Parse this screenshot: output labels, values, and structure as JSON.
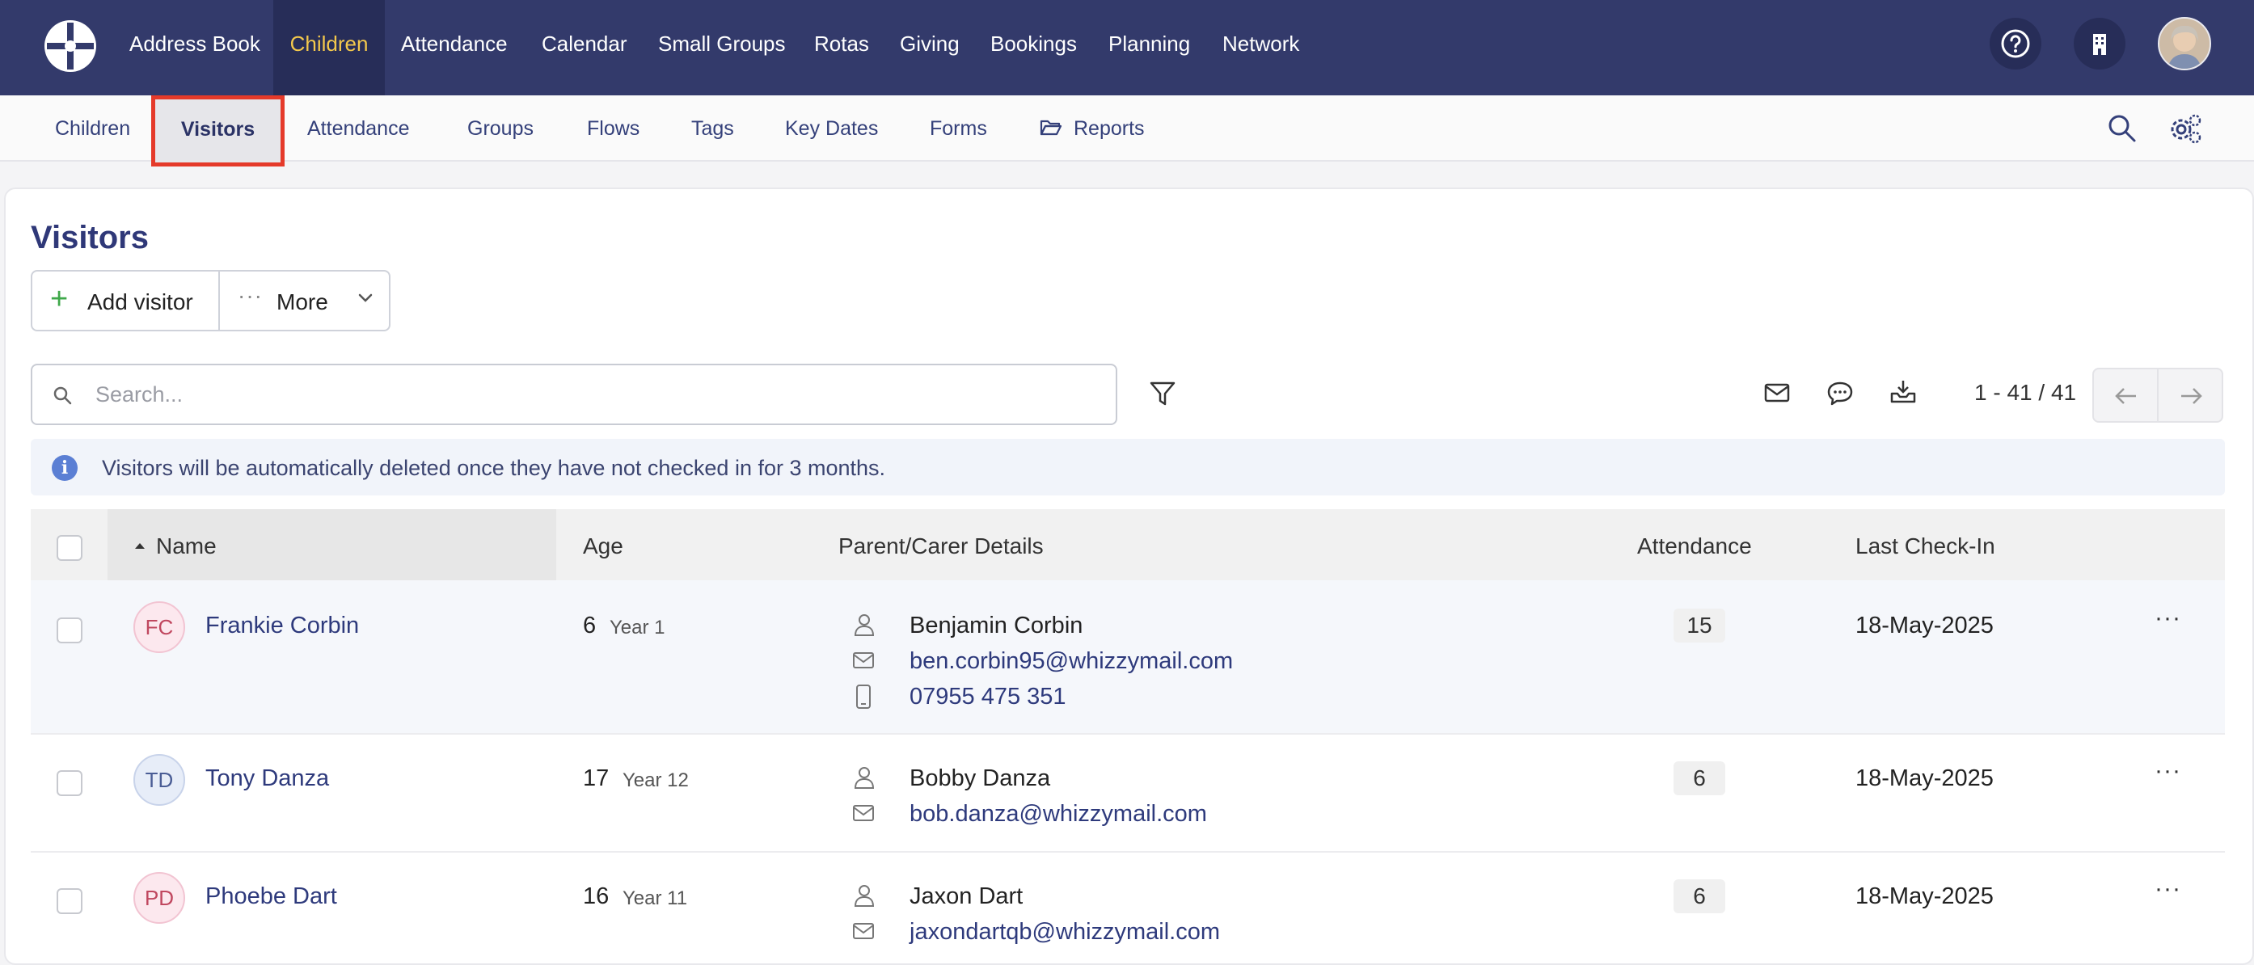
{
  "topnav": {
    "items": [
      "Address Book",
      "Children",
      "Attendance",
      "Calendar",
      "Small Groups",
      "Rotas",
      "Giving",
      "Bookings",
      "Planning",
      "Network"
    ],
    "active": "Children"
  },
  "subnav": {
    "items": [
      "Children",
      "Visitors",
      "Attendance",
      "Groups",
      "Flows",
      "Tags",
      "Key Dates",
      "Forms",
      "Reports"
    ],
    "active": "Visitors"
  },
  "page": {
    "title": "Visitors",
    "add_label": "Add visitor",
    "more_label": "More",
    "search_placeholder": "Search...",
    "pager": "1 - 41 / 41",
    "notice": "Visitors will be automatically deleted once they have not checked in for 3 months."
  },
  "table": {
    "headers": {
      "name": "Name",
      "age": "Age",
      "parent": "Parent/Carer Details",
      "attendance": "Attendance",
      "last": "Last Check-In"
    },
    "rows": [
      {
        "initials": "FC",
        "name": "Frankie Corbin",
        "age": "6",
        "year": "Year 1",
        "parent": "Benjamin Corbin",
        "email": "ben.corbin95@whizzymail.com",
        "phone": "07955 475 351",
        "attendance": "15",
        "last": "18-May-2025"
      },
      {
        "initials": "TD",
        "name": "Tony Danza",
        "age": "17",
        "year": "Year 12",
        "parent": "Bobby Danza",
        "email": "bob.danza@whizzymail.com",
        "attendance": "6",
        "last": "18-May-2025"
      },
      {
        "initials": "PD",
        "name": "Phoebe Dart",
        "age": "16",
        "year": "Year 11",
        "parent": "Jaxon Dart",
        "email": "jaxondartqb@whizzymail.com",
        "attendance": "6",
        "last": "18-May-2025"
      }
    ]
  },
  "colors": {
    "nav_bg": "#333a6b",
    "active_nav": "#f3c84c",
    "highlight_box": "#e53a2a",
    "link": "#2e3a7c"
  }
}
